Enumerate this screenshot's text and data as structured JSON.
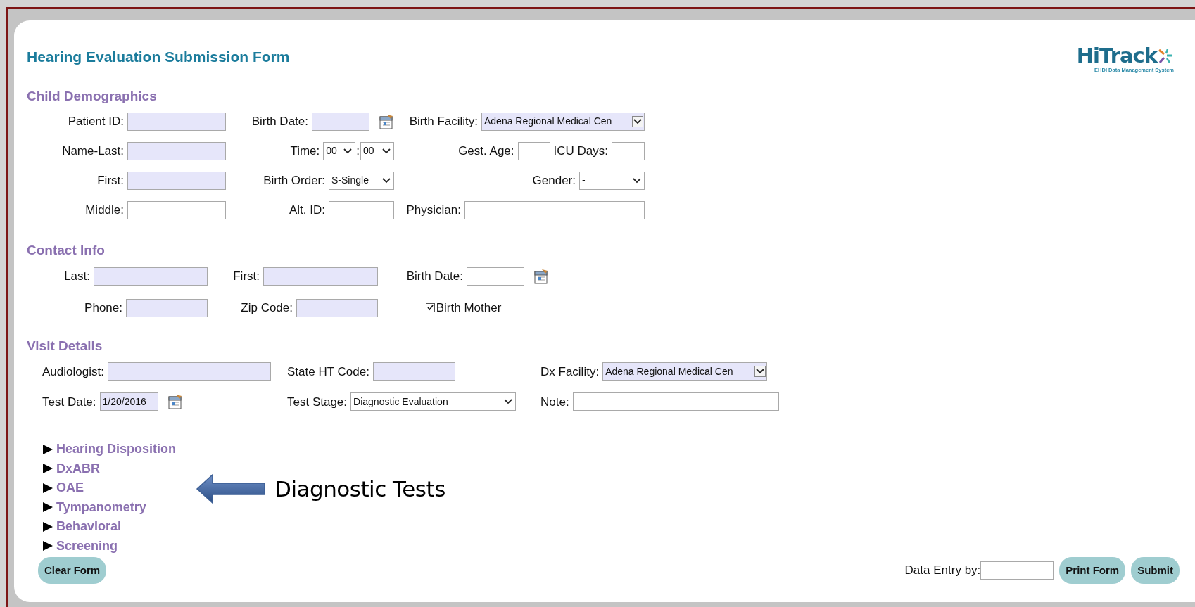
{
  "title": "Hearing Evaluation Submission Form",
  "logo": {
    "name": "HiTrack",
    "tagline": "EHDI Data Management System"
  },
  "sections": [
    {
      "title": "Child Demographics",
      "rows": [
        [
          [
            {
              "label": "Patient ID:",
              "kind": "text",
              "required": true
            }
          ],
          [
            {
              "label": "Birth Date:",
              "kind": "date",
              "required": true
            }
          ],
          [
            {
              "label": "Birth Facility:",
              "kind": "select",
              "value": "Adena Regional Medical Cen",
              "required": true
            }
          ]
        ],
        [
          [
            {
              "label": "Name-Last:",
              "kind": "text",
              "required": true
            }
          ],
          [
            {
              "label": "Time:",
              "kind": "select",
              "value": "00",
              "required": false
            },
            {
              "label": ":",
              "kind": "select",
              "value": "00",
              "required": false
            }
          ],
          [
            {
              "label": "Gest. Age:",
              "kind": "text",
              "required": false
            },
            {
              "label": "ICU Days:",
              "kind": "text",
              "required": false
            }
          ]
        ],
        [
          [
            {
              "label": "First:",
              "kind": "text",
              "required": true
            }
          ],
          [
            {
              "label": "Birth Order:",
              "kind": "select",
              "value": "S-Single",
              "required": false
            }
          ],
          [
            {
              "label": "Gender:",
              "kind": "select",
              "value": "-",
              "required": false
            }
          ]
        ],
        [
          [
            {
              "label": "Middle:",
              "kind": "text",
              "required": false
            }
          ],
          [
            {
              "label": "Alt. ID:",
              "kind": "text",
              "required": false
            }
          ],
          [
            {
              "label": "Physician:",
              "kind": "text",
              "required": false
            }
          ]
        ]
      ]
    },
    {
      "title": "Contact Info",
      "rows": [
        [
          [
            {
              "label": "Last:",
              "kind": "text",
              "required": true
            }
          ],
          [
            {
              "label": "First:",
              "kind": "text",
              "required": true
            }
          ],
          [
            {
              "label": "Birth Date:",
              "kind": "date",
              "required": false
            }
          ]
        ],
        [
          [
            {
              "label": "Phone:",
              "kind": "text",
              "required": true
            }
          ],
          [
            {
              "label": "Zip Code:",
              "kind": "text",
              "required": true
            }
          ],
          [
            {
              "label": "Birth Mother",
              "kind": "checkbox",
              "checked": true
            }
          ]
        ]
      ]
    },
    {
      "title": "Visit Details",
      "rows": [
        [
          [
            {
              "label": "Audiologist:",
              "kind": "text",
              "required": true
            }
          ],
          [
            {
              "label": "State HT Code:",
              "kind": "text",
              "required": true
            }
          ],
          [
            {
              "label": "Dx Facility:",
              "kind": "select",
              "value": "Adena Regional Medical Cen",
              "required": true
            }
          ]
        ],
        [
          [
            {
              "label": "Test Date:",
              "kind": "date",
              "value": "1/20/2016",
              "required": true
            }
          ],
          [
            {
              "label": "Test Stage:",
              "kind": "select",
              "value": "Diagnostic Evaluation",
              "required": false
            }
          ],
          [
            {
              "label": "Note:",
              "kind": "text",
              "required": false
            }
          ]
        ]
      ]
    }
  ],
  "expanders": [
    {
      "label": "Hearing Disposition",
      "expanded": false
    },
    {
      "label": "DxABR",
      "expanded": false
    },
    {
      "label": "OAE",
      "expanded": false
    },
    {
      "label": "Tympanometry",
      "expanded": false
    },
    {
      "label": "Behavioral",
      "expanded": false
    },
    {
      "label": "Screening",
      "expanded": false
    }
  ],
  "callout": "Diagnostic Tests",
  "footer": {
    "clear_button": "Clear Form",
    "data_entry_label": "Data Entry by:",
    "print_button": "Print Form",
    "submit_button": "Submit"
  }
}
